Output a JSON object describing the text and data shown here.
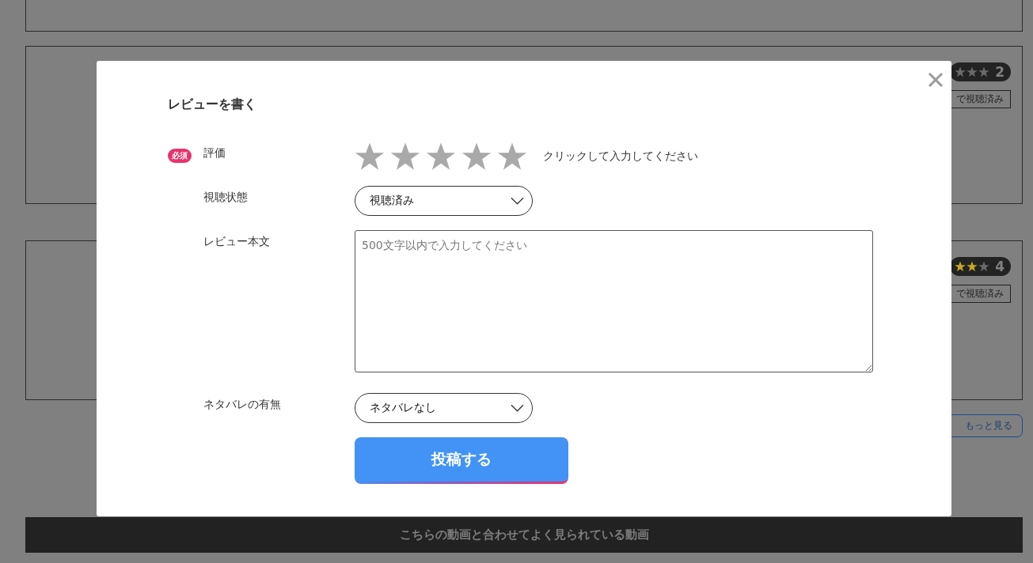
{
  "background_cards": [
    {
      "kind": "empty"
    },
    {
      "kind": "review",
      "stars": 0,
      "rating": "2",
      "tag": "で視聴済み"
    },
    {
      "kind": "review",
      "stars": 2,
      "rating": "4",
      "tag": "で視聴済み"
    }
  ],
  "more_button": "もっと見る",
  "footer_title": "こちらの動画と合わせてよく見られている動画",
  "modal": {
    "title": "レビューを書く",
    "required_badge": "必須",
    "submit": "投稿する",
    "fields": [
      {
        "kind": "stars",
        "label": "評価",
        "required": true,
        "stars": 0,
        "hint": "クリックして入力してください"
      },
      {
        "kind": "select",
        "label": "視聴状態",
        "required": false,
        "value": "視聴済み"
      },
      {
        "kind": "textarea",
        "label": "レビュー本文",
        "required": false,
        "placeholder": "500文字以内で入力してください"
      },
      {
        "kind": "select",
        "label": "ネタバレの有無",
        "required": false,
        "value": "ネタバレなし"
      }
    ]
  }
}
